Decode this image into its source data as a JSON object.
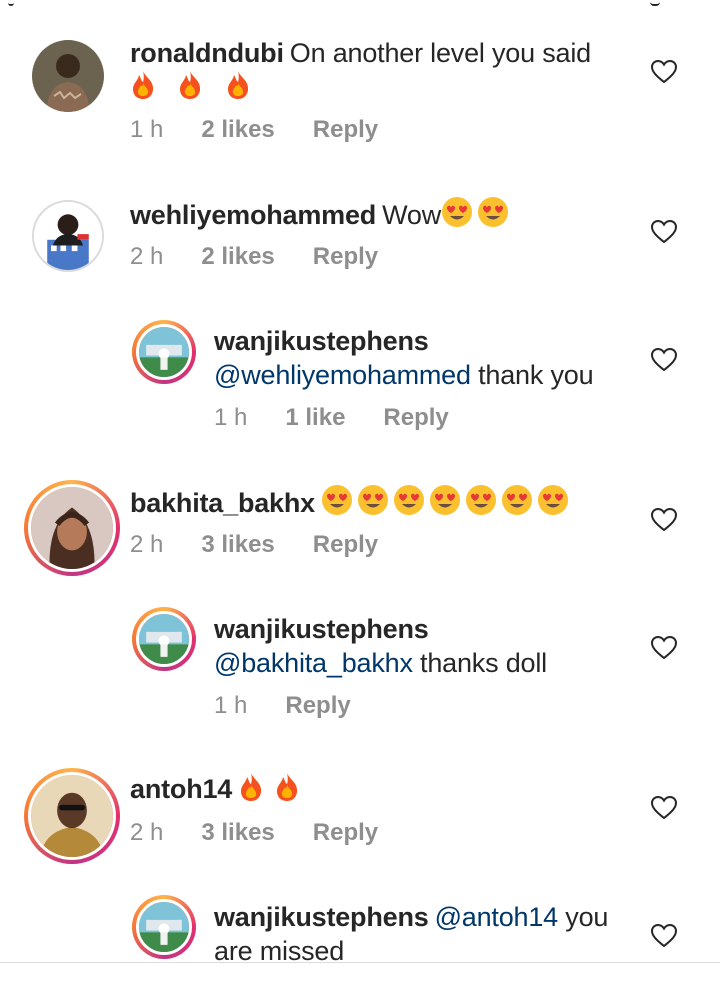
{
  "comments": [
    {
      "username": "ronaldndubi",
      "text": "On another level you said",
      "emoji_count": 3,
      "emoji": "fire-emoji",
      "time": "1 h",
      "likes": "2 likes",
      "reply": "Reply"
    },
    {
      "username": "wehliyemohammed",
      "text": "Wow",
      "emoji_count": 2,
      "emoji": "heart-eyes-emoji",
      "time": "2 h",
      "likes": "2 likes",
      "reply": "Reply"
    },
    {
      "username": "wanjikustephens",
      "mention": "@wehliyemohammed",
      "text": " thank you",
      "time": "1 h",
      "likes": "1 like",
      "reply": "Reply"
    },
    {
      "username": "bakhita_bakhx",
      "emoji_count": 7,
      "emoji": "heart-eyes-emoji",
      "time": "2 h",
      "likes": "3 likes",
      "reply": "Reply"
    },
    {
      "username": "wanjikustephens",
      "mention": "@bakhita_bakhx",
      "text": " thanks doll",
      "time": "1 h",
      "reply": "Reply"
    },
    {
      "username": "antoh14",
      "emoji_count": 2,
      "emoji": "fire-emoji",
      "time": "2 h",
      "likes": "3 likes",
      "reply": "Reply"
    },
    {
      "username": "wanjikustephens",
      "mention": "@antoh14",
      "text": " you",
      "text_line2": "are missed"
    }
  ],
  "colors": {
    "text": "#262626",
    "meta": "#8e8e8e",
    "mention": "#00376b",
    "story_ring": "#e1306c"
  }
}
